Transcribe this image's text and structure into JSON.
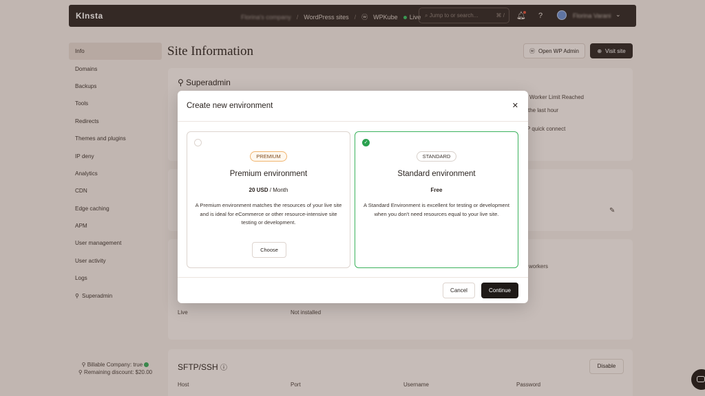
{
  "topbar": {
    "logo": "KInsta",
    "company": "Florina's company",
    "breadcrumb_sites": "WordPress sites",
    "breadcrumb_site": "WPKube",
    "status": "Live",
    "search_placeholder": "Jump to or search...",
    "search_shortcut": "⌘ /",
    "user_name": "Florina Varani"
  },
  "sidebar": {
    "items": [
      {
        "label": "Info"
      },
      {
        "label": "Domains"
      },
      {
        "label": "Backups"
      },
      {
        "label": "Tools"
      },
      {
        "label": "Redirects"
      },
      {
        "label": "Themes and plugins"
      },
      {
        "label": "IP deny"
      },
      {
        "label": "Analytics"
      },
      {
        "label": "CDN"
      },
      {
        "label": "Edge caching"
      },
      {
        "label": "APM"
      },
      {
        "label": "User management"
      },
      {
        "label": "User activity"
      },
      {
        "label": "Logs"
      },
      {
        "label": "Superadmin"
      }
    ],
    "billable_label": "Billable Company: true",
    "remaining_label": "Remaining discount: $20.00"
  },
  "main": {
    "title": "Site Information",
    "open_wp_admin": "Open WP Admin",
    "visit_site": "Visit site",
    "superadmin_heading": "Superadmin",
    "bg_worker_limit": "Worker Limit Reached",
    "bg_last_hour": "the last hour",
    "bg_quick_connect": "P quick connect",
    "bg_workers": "workers",
    "bg_live": "Live",
    "bg_not_installed": "Not installed",
    "sftp_heading": "SFTP/SSH",
    "disable_button": "Disable",
    "sftp_columns": [
      "Host",
      "Port",
      "Username",
      "Password"
    ]
  },
  "modal": {
    "title": "Create new environment",
    "options": [
      {
        "badge": "PREMIUM",
        "title": "Premium environment",
        "price_amount": "20 USD",
        "price_period": " / Month",
        "description": "A Premium environment matches the resources of your live site and is ideal for eCommerce or other resource-intensive site testing or development.",
        "choose": "Choose"
      },
      {
        "badge": "STANDARD",
        "title": "Standard environment",
        "price_amount": "Free",
        "description": "A Standard Environment is excellent for testing or development when you don't need resources equal to your live site."
      }
    ],
    "cancel": "Cancel",
    "continue": "Continue"
  },
  "colors": {
    "accent_green": "#3bb25c",
    "dark": "#2e2724",
    "premium_badge": "#f0b46e"
  }
}
